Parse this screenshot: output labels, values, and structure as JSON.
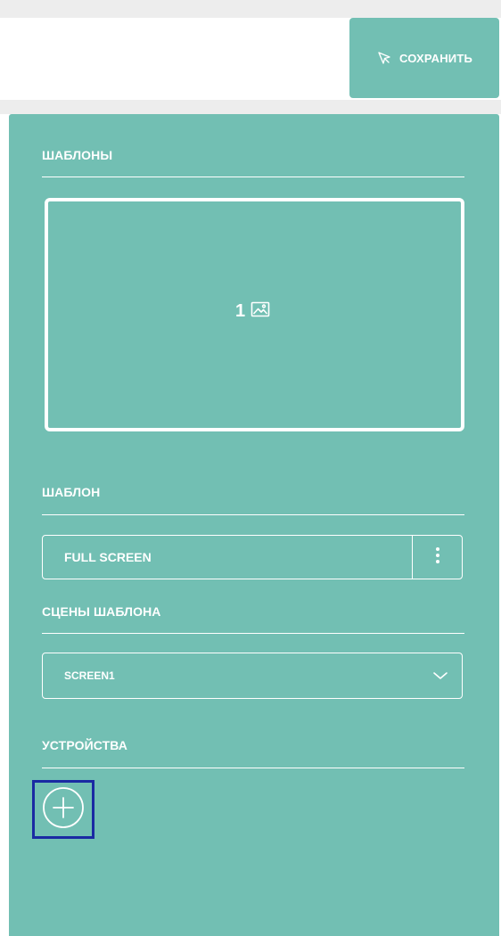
{
  "toolbar": {
    "save_label": "СОХРАНИТЬ",
    "save_icon": "pointer-cursor-icon"
  },
  "panel": {
    "templates_title": "ШАБЛОНЫ",
    "template_card": {
      "number": "1",
      "icon": "image-icon"
    },
    "template_title": "ШАБЛОН",
    "template_value": "FULL SCREEN",
    "template_menu_icon": "kebab-icon",
    "scenes_title": "СЦЕНЫ ШАБЛОНА",
    "scene_value": "SCREEN1",
    "scene_chevron_icon": "chevron-down-icon",
    "devices_title": "УСТРОЙСТВА",
    "add_device_icon": "plus-circle-icon"
  },
  "colors": {
    "accent": "#72bfb3",
    "background": "#ffffff",
    "strip": "#ededed",
    "focus_border": "#1a2aa3",
    "text": "#ffffff"
  }
}
